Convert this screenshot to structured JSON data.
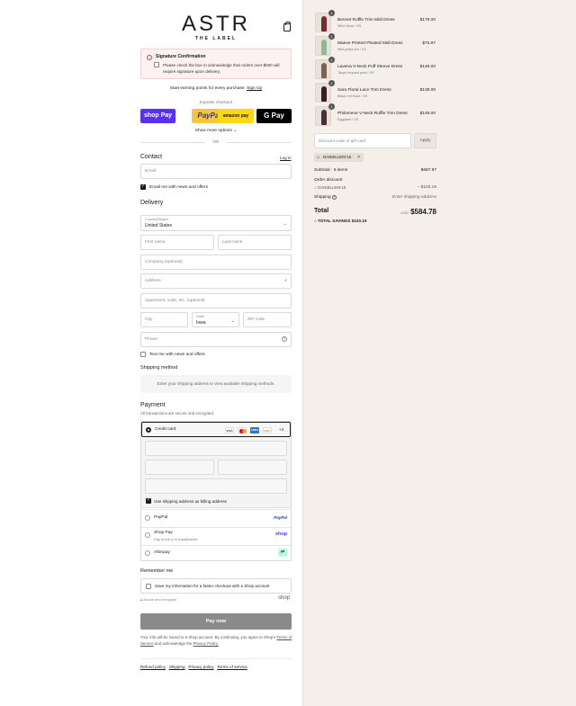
{
  "brand": {
    "name": "ASTR",
    "tagline": "THE LABEL"
  },
  "notice": {
    "title": "Signature Confirmation",
    "body": "Please check the box to acknowledge that orders over $500 will require signature upon delivery."
  },
  "rewards": {
    "text": "Start earning points for every purchase.",
    "link": "Sign Up"
  },
  "express": {
    "label": "Express checkout",
    "buttons": [
      {
        "label": "shop Pay",
        "color": "#5a31f4",
        "text_color": "#ffffff"
      },
      {
        "label": "PayPal",
        "color": "#ffc439",
        "text_color": "#253b80"
      },
      {
        "label": "amazon pay",
        "color": "#ffd814",
        "text_color": "#1a1a1a"
      },
      {
        "label": "G Pay",
        "color": "#000000",
        "text_color": "#ffffff"
      }
    ],
    "show_more": "Show more options",
    "or": "OR"
  },
  "contact": {
    "heading": "Contact",
    "login": "Log in",
    "email_placeholder": "Email",
    "email_news": "Email me with news and offers"
  },
  "delivery": {
    "heading": "Delivery",
    "country_label": "Country/Region",
    "country_value": "United States",
    "first_name": "First name",
    "last_name": "Last name",
    "company": "Company (optional)",
    "address": "Address",
    "apartment": "Apartment, suite, etc. (optional)",
    "city": "City",
    "state_label": "State",
    "state_value": "Iowa",
    "zip": "ZIP code",
    "phone": "Phone",
    "text_news": "Text me with news and offers"
  },
  "shipping": {
    "heading": "Shipping method",
    "placeholder": "Enter your shipping address to view available shipping methods."
  },
  "payment": {
    "heading": "Payment",
    "sub": "All transactions are secure and encrypted.",
    "credit_card": "Credit card",
    "more_cards": "+4",
    "billing_same": "Use shipping address as billing address",
    "paypal": "PayPal",
    "shop_pay": "Shop Pay",
    "shop_pay_sub": "Pay in full or in installments",
    "afterpay": "Afterpay",
    "card_logos": [
      "VISA",
      "MC",
      "AMEX",
      "DISC"
    ]
  },
  "remember": {
    "heading": "Remember me",
    "save_info": "Save my information for a faster checkout with a Shop account",
    "secure": "Secure and encrypted",
    "shop": "shop"
  },
  "pay_now": "Pay now",
  "legal": {
    "text1": "Your info will be saved to a Shop account. By continuing, you agree to Shop's",
    "terms": "Terms of Service",
    "text2": "and acknowledge the",
    "privacy": "Privacy Policy."
  },
  "footer_links": [
    "Refund policy",
    "Shipping",
    "Privacy policy",
    "Terms of service"
  ],
  "cart": {
    "items": [
      {
        "name": "Bennet Ruffle Trim Midi Dress",
        "variant": "Wine floral / XS",
        "price": "$178.00",
        "qty": "1",
        "color": "#7a2a35"
      },
      {
        "name": "Maeve Printed Pleated Midi Dress",
        "variant": "Mint polka dot / XS",
        "price": "$75.97",
        "qty": "1",
        "color": "#8fb89a"
      },
      {
        "name": "Lavena V-Neck Puff Sleeve Dress",
        "variant": "Taupe leopard print / XS",
        "price": "$148.00",
        "qty": "1",
        "color": "#7d6250"
      },
      {
        "name": "Sara Floral Lace Trim Dress",
        "variant": "Black red floral / XS",
        "price": "$138.00",
        "qty": "1",
        "color": "#3a1f22"
      },
      {
        "name": "Philomene V-Neck Ruffle Trim Dress",
        "variant": "Eggplant / XS",
        "price": "$148.00",
        "qty": "1",
        "color": "#4a2d3a"
      }
    ],
    "discount_placeholder": "Discount code or gift card",
    "apply": "Apply",
    "code_chip": "DANIELLEM-15",
    "subtotal_label": "Subtotal · 5 items",
    "subtotal": "$687.97",
    "order_discount": "Order discount",
    "discount_code": "DANIELLEM-15",
    "discount_amount": "– $103.19",
    "shipping_label": "Shipping",
    "shipping_value": "Enter shipping address",
    "total_label": "Total",
    "currency": "USD",
    "total": "$584.78",
    "savings_label": "TOTAL SAVINGS",
    "savings": "$103.19"
  }
}
